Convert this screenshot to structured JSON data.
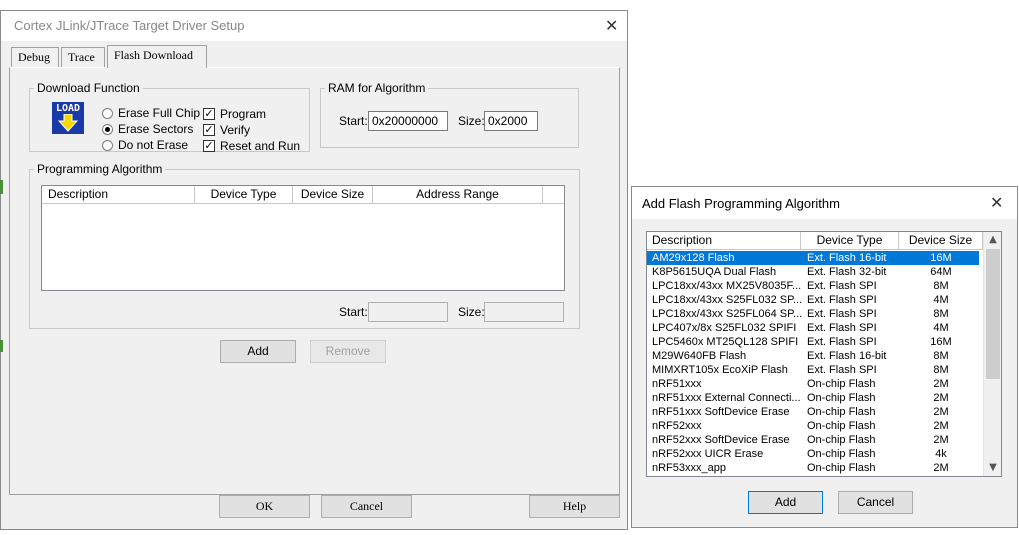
{
  "main_dialog": {
    "title": "Cortex JLink/JTrace Target Driver Setup",
    "close_glyph": "✕",
    "tabs": [
      "Debug",
      "Trace",
      "Flash Download"
    ],
    "active_tab": "Flash Download",
    "download_function": {
      "label": "Download Function",
      "icon": "load-icon",
      "icon_text": "LOAD",
      "radios": [
        {
          "label": "Erase Full Chip",
          "checked": false
        },
        {
          "label": "Erase Sectors",
          "checked": true
        },
        {
          "label": "Do not Erase",
          "checked": false
        }
      ],
      "checkboxes": [
        {
          "label": "Program",
          "checked": true
        },
        {
          "label": "Verify",
          "checked": true
        },
        {
          "label": "Reset and Run",
          "checked": true
        }
      ]
    },
    "ram_for_algorithm": {
      "label": "RAM for Algorithm",
      "start_label": "Start:",
      "start_value": "0x20000000",
      "size_label": "Size:",
      "size_value": "0x2000"
    },
    "programming_algorithm": {
      "label": "Programming Algorithm",
      "columns": [
        "Description",
        "Device Type",
        "Device Size",
        "Address Range"
      ],
      "rows": [],
      "start_label": "Start:",
      "start_value": "",
      "size_label": "Size:",
      "size_value": ""
    },
    "buttons": {
      "add": "Add",
      "remove": "Remove",
      "ok": "OK",
      "cancel": "Cancel",
      "help": "Help"
    }
  },
  "add_dialog": {
    "title": "Add Flash Programming Algorithm",
    "close_glyph": "✕",
    "columns": [
      "Description",
      "Device Type",
      "Device Size"
    ],
    "rows": [
      {
        "description": "AM29x128 Flash",
        "type": "Ext. Flash 16-bit",
        "size": "16M",
        "selected": true
      },
      {
        "description": "K8P5615UQA Dual Flash",
        "type": "Ext. Flash 32-bit",
        "size": "64M"
      },
      {
        "description": "LPC18xx/43xx MX25V8035F...",
        "type": "Ext. Flash SPI",
        "size": "8M"
      },
      {
        "description": "LPC18xx/43xx S25FL032 SP...",
        "type": "Ext. Flash SPI",
        "size": "4M"
      },
      {
        "description": "LPC18xx/43xx S25FL064 SP...",
        "type": "Ext. Flash SPI",
        "size": "8M"
      },
      {
        "description": "LPC407x/8x S25FL032 SPIFI",
        "type": "Ext. Flash SPI",
        "size": "4M"
      },
      {
        "description": "LPC5460x MT25QL128 SPIFI",
        "type": "Ext. Flash SPI",
        "size": "16M"
      },
      {
        "description": "M29W640FB Flash",
        "type": "Ext. Flash 16-bit",
        "size": "8M"
      },
      {
        "description": "MIMXRT105x EcoXiP Flash",
        "type": "Ext. Flash SPI",
        "size": "8M"
      },
      {
        "description": "nRF51xxx",
        "type": "On-chip Flash",
        "size": "2M"
      },
      {
        "description": "nRF51xxx External Connecti...",
        "type": "On-chip Flash",
        "size": "2M"
      },
      {
        "description": "nRF51xxx SoftDevice Erase",
        "type": "On-chip Flash",
        "size": "2M"
      },
      {
        "description": "nRF52xxx",
        "type": "On-chip Flash",
        "size": "2M"
      },
      {
        "description": "nRF52xxx SoftDevice Erase",
        "type": "On-chip Flash",
        "size": "2M"
      },
      {
        "description": "nRF52xxx UICR Erase",
        "type": "On-chip Flash",
        "size": "4k"
      },
      {
        "description": "nRF53xxx_app",
        "type": "On-chip Flash",
        "size": "2M"
      }
    ],
    "scroll_up_glyph": "▲",
    "scroll_down_glyph": "▼",
    "buttons": {
      "add": "Add",
      "cancel": "Cancel"
    }
  },
  "colors": {
    "dialog_bg": "#f0f0f0",
    "selection": "#0078d7",
    "load_icon_bg": "#1a3aa8",
    "load_icon_arrow": "#f5d800"
  }
}
